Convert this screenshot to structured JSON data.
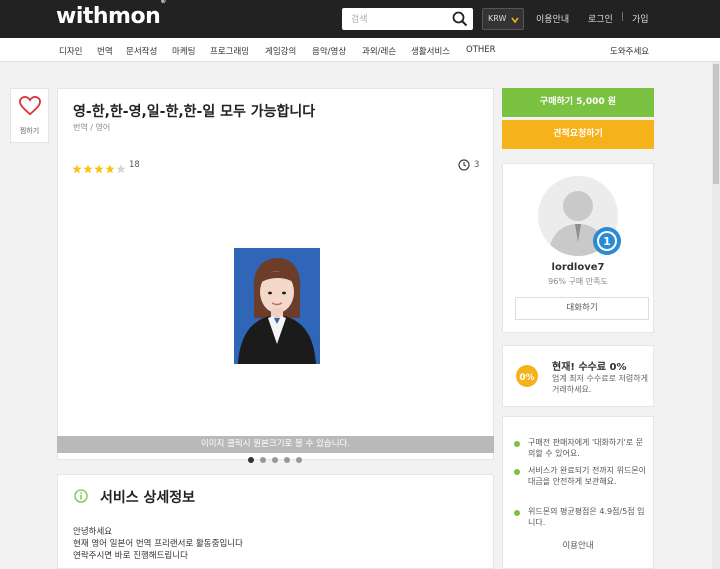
{
  "header": {
    "logo": "withmon",
    "logo_mark": "®",
    "search_placeholder": "검색",
    "currency": "KRW",
    "links": {
      "guide": "이용안내",
      "login": "로그인",
      "sep": "|",
      "signup": "가입"
    }
  },
  "categories": [
    "디자인",
    "번역",
    "문서작성",
    "마케팅",
    "프로그래밍",
    "게임강의",
    "음악/영상",
    "과외/레슨",
    "생활서비스",
    "OTHER"
  ],
  "help_link": "도와주세요",
  "like_label": "찜하기",
  "service": {
    "title": "영-한,한-영,일-한,한-일 모두 가능합니다",
    "category": "번역 / 영어",
    "rating": 4,
    "rating_max": 5,
    "review_count": "18",
    "delivery_days": "3",
    "image_caption": "이미지 클릭시 원본크기로 볼 수 있습니다.",
    "slides": 5,
    "active_slide": 1
  },
  "detail": {
    "title": "서비스 상세정보",
    "lines": [
      "안녕하세요",
      "현재 영어 일본어 번역 프리랜서로 활동중입니다",
      "연락주시면 바로 진행해드립니다"
    ]
  },
  "buy_button": "구매하기 5,000 원",
  "quote_button": "견적요청하기",
  "seller": {
    "name": "lordlove7",
    "satisfaction": "96% 구매 만족도",
    "chat_button": "대화하기",
    "rank": "1"
  },
  "fee": {
    "badge": "0%",
    "title": "현재! 수수료 0%",
    "desc": "업계 최저 수수료로 저렴하게 거래하세요."
  },
  "notices": [
    "구매전 판매자에게 '대화하기'로 문의할 수 있어요.",
    "서비스가 완료되기 전까지 위드몬이 대금을 안전하게 보관해요.",
    "위드몬의 평균평점은 4.9점/5점 입니다."
  ],
  "notice_link": "이용안내",
  "colors": {
    "green": "#7bc142",
    "orange": "#f5b21a",
    "header": "#222222",
    "star": "#f5c518"
  }
}
